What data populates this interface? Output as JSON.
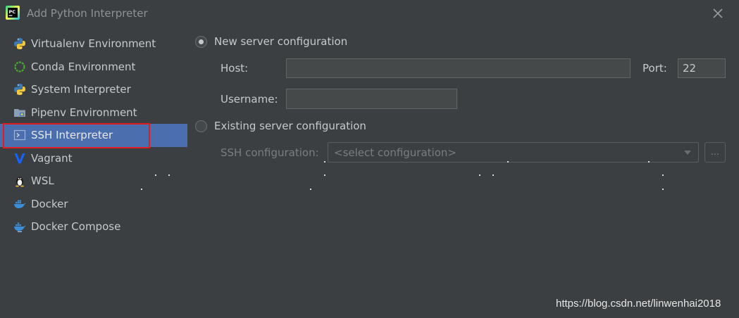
{
  "window": {
    "title": "Add Python Interpreter",
    "app_icon_text": "PC"
  },
  "sidebar": {
    "items": [
      {
        "label": "Virtualenv Environment",
        "icon": "python-icon"
      },
      {
        "label": "Conda Environment",
        "icon": "conda-icon"
      },
      {
        "label": "System Interpreter",
        "icon": "python-icon"
      },
      {
        "label": "Pipenv Environment",
        "icon": "pipenv-icon"
      },
      {
        "label": "SSH Interpreter",
        "icon": "terminal-icon",
        "selected": true
      },
      {
        "label": "Vagrant",
        "icon": "vagrant-icon"
      },
      {
        "label": "WSL",
        "icon": "linux-penguin-icon"
      },
      {
        "label": "Docker",
        "icon": "docker-icon"
      },
      {
        "label": "Docker Compose",
        "icon": "docker-compose-icon"
      }
    ]
  },
  "main": {
    "new_server": {
      "label": "New server configuration",
      "selected": true,
      "host_label": "Host:",
      "host_value": "",
      "port_label": "Port:",
      "port_value": "22",
      "username_label": "Username:",
      "username_value": ""
    },
    "existing_server": {
      "label": "Existing server configuration",
      "selected": false,
      "ssh_config_label": "SSH configuration:",
      "ssh_config_placeholder": "<select configuration>",
      "browse_label": "..."
    }
  },
  "watermark": "https://blog.csdn.net/linwenhai2018",
  "colors": {
    "background": "#3c3f41",
    "selection": "#4b6eaf",
    "highlight_border": "#e01c1c"
  }
}
